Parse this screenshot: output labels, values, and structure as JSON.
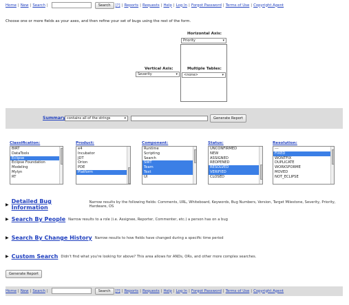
{
  "nav": {
    "home": "Home",
    "new": "New",
    "search": "Search",
    "search_button": "Search",
    "help_q": "[?]",
    "reports": "Reports",
    "requests": "Requests",
    "help": "Help",
    "login": "Log In",
    "forgot": "Forgot Password",
    "terms": "Terms of Use",
    "copyright": "Copyright Agent",
    "sep": "|"
  },
  "intro": "Choose one or more fields as your axes, and then refine your set of bugs using the rest of the form.",
  "axes": {
    "horizontal_label": "Horizontal Axis:",
    "horizontal_value": "Priority",
    "vertical_label": "Vertical Axis:",
    "vertical_value": "Severity",
    "tables_label": "Multiple Tables:",
    "tables_value": "<none>"
  },
  "summary": {
    "label": "Summary:",
    "operator": "contains all of the strings",
    "generate": "Generate Report"
  },
  "columns": [
    {
      "header": "Classification:",
      "items": [
        {
          "text": "BIRT",
          "selected": false
        },
        {
          "text": "DataTools",
          "selected": false
        },
        {
          "text": "Eclipse",
          "selected": true
        },
        {
          "text": "Eclipse Foundation",
          "selected": false
        },
        {
          "text": "Modeling",
          "selected": false
        },
        {
          "text": "Mylyn",
          "selected": false
        },
        {
          "text": "RT",
          "selected": false
        }
      ]
    },
    {
      "header": "Product:",
      "items": [
        {
          "text": "e4",
          "selected": false
        },
        {
          "text": "Incubator",
          "selected": false
        },
        {
          "text": "JDT",
          "selected": false
        },
        {
          "text": "Orion",
          "selected": false
        },
        {
          "text": "PDE",
          "selected": false
        },
        {
          "text": "Platform",
          "selected": true
        }
      ]
    },
    {
      "header": "Component:",
      "items": [
        {
          "text": "Runtime",
          "selected": false
        },
        {
          "text": "Scripting",
          "selected": false
        },
        {
          "text": "Search",
          "selected": false
        },
        {
          "text": "SWT",
          "selected": true
        },
        {
          "text": "Team",
          "selected": true
        },
        {
          "text": "Text",
          "selected": true
        },
        {
          "text": "UI",
          "selected": false
        }
      ]
    },
    {
      "header": "Status:",
      "items": [
        {
          "text": "UNCONFIRMED",
          "selected": false
        },
        {
          "text": "NEW",
          "selected": false
        },
        {
          "text": "ASSIGNED",
          "selected": false
        },
        {
          "text": "REOPENED",
          "selected": false
        },
        {
          "text": "RESOLVED",
          "selected": true
        },
        {
          "text": "VERIFIED",
          "selected": true
        },
        {
          "text": "CLOSED",
          "selected": false
        }
      ]
    },
    {
      "header": "Resolution:",
      "items": [
        {
          "text": "---",
          "selected": false
        },
        {
          "text": "FIXED",
          "selected": true
        },
        {
          "text": "WONTFIX",
          "selected": false
        },
        {
          "text": "DUPLICATE",
          "selected": false
        },
        {
          "text": "WORKSFORME",
          "selected": false
        },
        {
          "text": "MOVED",
          "selected": false
        },
        {
          "text": "NOT_ECLIPSE",
          "selected": false
        }
      ]
    }
  ],
  "sections": [
    {
      "title": "Detailed Bug Information",
      "desc": "Narrow results by the following fields: Comments, URL, Whiteboard, Keywords, Bug Numbers, Version, Target Milestone, Severity, Priority, Hardware, OS"
    },
    {
      "title": "Search By People",
      "desc": "Narrow results to a role (i.e. Assignee, Reporter, Commenter, etc.) a person has on a bug"
    },
    {
      "title": "Search By Change History",
      "desc": "Narrow results to how fields have changed during a specific time period"
    },
    {
      "title": "Custom Search",
      "desc": "Didn't find what you're looking for above? This area allows for ANDs, ORs, and other more complex searches."
    }
  ],
  "generate_bottom": "Generate Report",
  "colors": {
    "link": "#1f3fbf",
    "selected": "#3b7fe6",
    "panel": "#dcdcdc"
  }
}
